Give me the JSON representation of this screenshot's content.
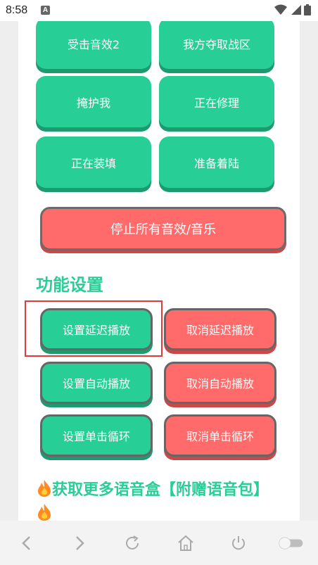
{
  "status_bar": {
    "time": "8:58",
    "notification_icon_text": "A"
  },
  "sound_buttons": [
    {
      "label": "受击音效2"
    },
    {
      "label": "我方夺取战区"
    },
    {
      "label": "掩护我"
    },
    {
      "label": "正在修理"
    },
    {
      "label": "正在装填"
    },
    {
      "label": "准备着陆"
    }
  ],
  "stop_button_label": "停止所有音效/音乐",
  "section_title": "功能设置",
  "function_buttons": [
    {
      "label": "设置延迟播放"
    },
    {
      "label": "取消延迟播放"
    },
    {
      "label": "设置自动播放"
    },
    {
      "label": "取消自动播放"
    },
    {
      "label": "设置单击循环"
    },
    {
      "label": "取消单击循环"
    }
  ],
  "promo_text": "获取更多语音盒【附赠语音包】",
  "colors": {
    "green": "#27cf97",
    "red": "#ff6b6b",
    "highlight": "#e03a3a"
  },
  "nav_icons": [
    "back-icon",
    "forward-icon",
    "refresh-icon",
    "home-icon",
    "power-icon",
    "toggle-switch"
  ]
}
